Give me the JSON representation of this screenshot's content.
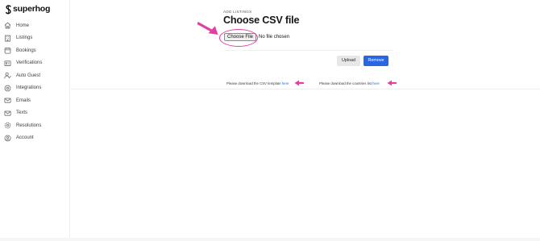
{
  "brand": {
    "name": "superhog",
    "logo_icon": "superhog-s-logo"
  },
  "sidebar": {
    "items": [
      {
        "label": "Home",
        "icon": "home-icon"
      },
      {
        "label": "Listings",
        "icon": "building-icon"
      },
      {
        "label": "Bookings",
        "icon": "calendar-icon"
      },
      {
        "label": "Verifications",
        "icon": "id-card-icon"
      },
      {
        "label": "Auto Guest",
        "icon": "user-check-icon"
      },
      {
        "label": "Integrations",
        "icon": "puzzle-icon"
      },
      {
        "label": "Emails",
        "icon": "mail-icon"
      },
      {
        "label": "Texts",
        "icon": "message-icon"
      },
      {
        "label": "Resolutions",
        "icon": "settings-icon"
      },
      {
        "label": "Account",
        "icon": "user-circle-icon"
      }
    ]
  },
  "main": {
    "eyebrow": "ADD LISTINGS",
    "title": "Choose CSV file",
    "file_input": {
      "button_label": "Choose File",
      "status": "No file chosen"
    },
    "buttons": {
      "upload": "Upload",
      "remove": "Remove"
    },
    "notes": [
      {
        "text": "Please download the CSV template ",
        "link": "here"
      },
      {
        "text": "Please download the countries list ",
        "link": "here"
      }
    ]
  },
  "colors": {
    "accent": "#2866e3",
    "annotation": "#e43ea0",
    "sidebar_icon": "#6a6a6a"
  }
}
